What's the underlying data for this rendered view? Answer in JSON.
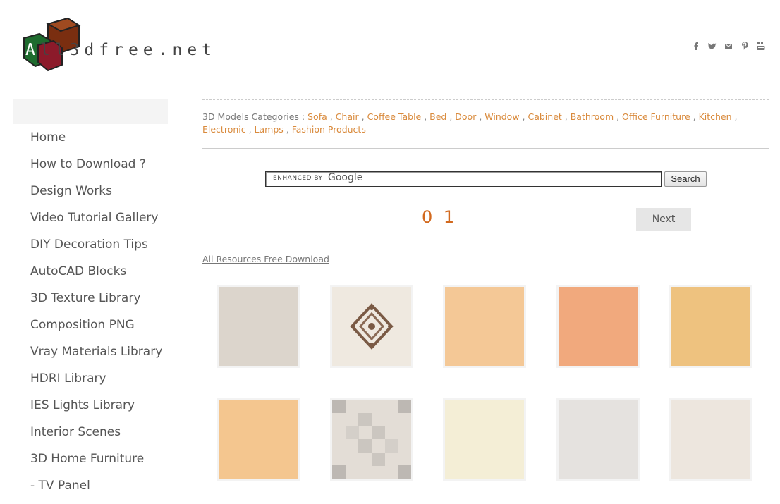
{
  "logo": {
    "text_a": "A",
    "text_rest": "ll3dfree.net"
  },
  "social_icons": [
    "facebook-icon",
    "twitter-icon",
    "mail-icon",
    "pinterest-icon",
    "youtube-icon"
  ],
  "sidebar": {
    "items": [
      {
        "label": "Home"
      },
      {
        "label": "How to Download ?"
      },
      {
        "label": "Design Works"
      },
      {
        "label": "Video Tutorial Gallery"
      },
      {
        "label": "DIY Decoration Tips"
      },
      {
        "label": "AutoCAD Blocks"
      },
      {
        "label": "3D Texture Library"
      },
      {
        "label": "Composition PNG"
      },
      {
        "label": "Vray Materials Library"
      },
      {
        "label": "HDRI Library"
      },
      {
        "label": "IES Lights Library"
      },
      {
        "label": "Interior Scenes"
      },
      {
        "label": "3D Home Furniture"
      },
      {
        "label": "- TV Panel"
      }
    ]
  },
  "categories": {
    "prefix": "3D Models Categories :",
    "links": [
      "Sofa",
      "Chair",
      "Coffee Table",
      "Bed",
      "Door",
      "Window",
      "Cabinet",
      "Bathroom",
      "Office Furniture",
      "Kitchen",
      "Electronic",
      "Lamps",
      "Fashion Products"
    ]
  },
  "search": {
    "enhanced_by": "ENHANCED BY",
    "google": "Google",
    "button": "Search"
  },
  "pagination": {
    "pages": "0 1",
    "next": "Next"
  },
  "all_resources": "All Resources Free Download",
  "tiles": [
    {
      "color": "#dcd5cc"
    },
    {
      "color": "#efe9e0"
    },
    {
      "color": "#f4c896"
    },
    {
      "color": "#f1a97d"
    },
    {
      "color": "#eec27f"
    },
    {
      "color": "#f4c68f"
    },
    {
      "color": "#e3ddd6"
    },
    {
      "color": "#f4eed6"
    },
    {
      "color": "#e5e2df"
    },
    {
      "color": "#ede6de"
    }
  ]
}
